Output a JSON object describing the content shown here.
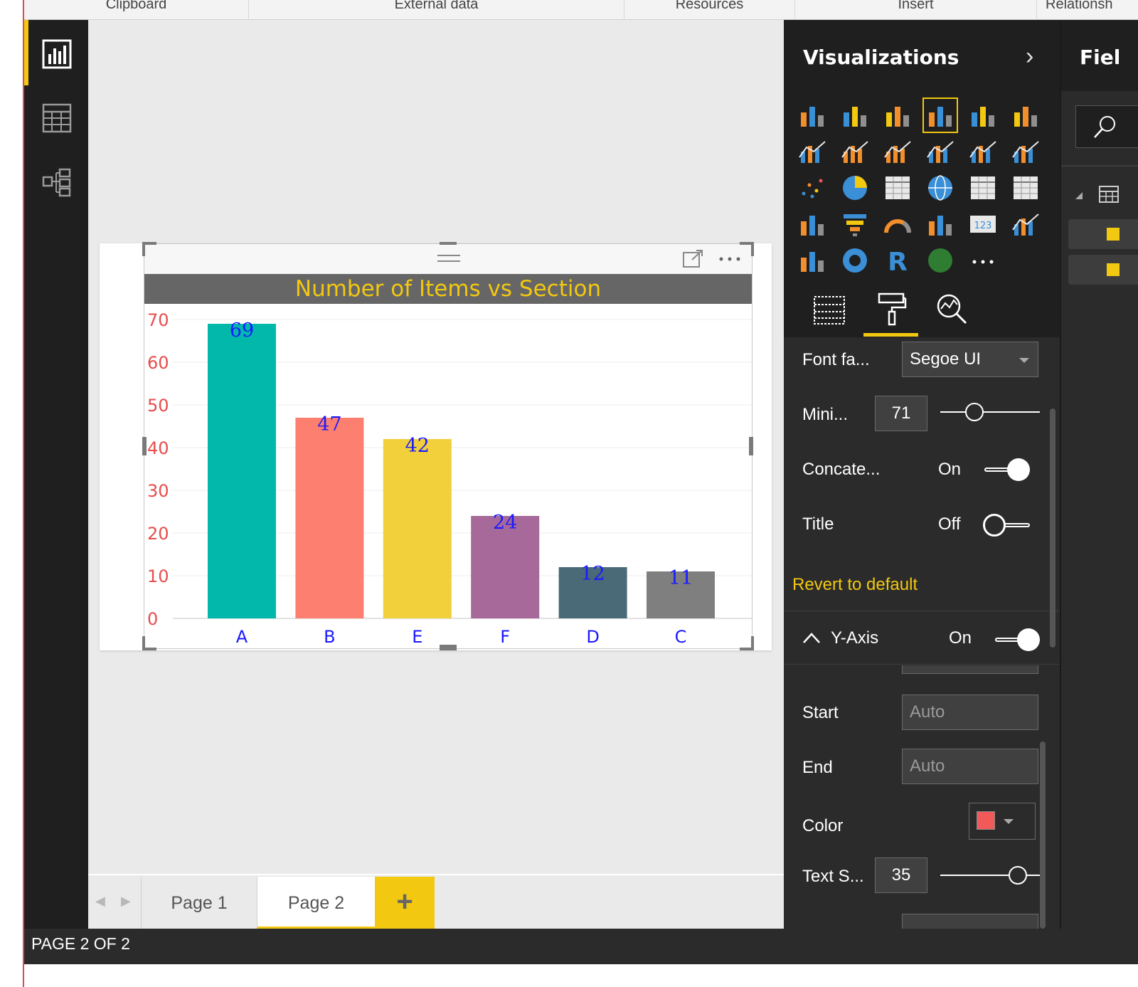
{
  "ribbon": {
    "groups": [
      {
        "label": "Clipboard"
      },
      {
        "label": "External data"
      },
      {
        "label": "Resources"
      },
      {
        "label": "Insert"
      },
      {
        "label": "Relationsh"
      }
    ]
  },
  "leftnav": {
    "items": [
      {
        "name": "report-view-icon",
        "active": true
      },
      {
        "name": "data-view-icon",
        "active": false
      },
      {
        "name": "relationships-view-icon",
        "active": false
      }
    ]
  },
  "visual": {
    "title": "Number of Items vs Section",
    "title_color": "#f2c811",
    "title_bg": "#666666"
  },
  "chart_data": {
    "type": "bar",
    "title": "Number of Items vs Section",
    "categories": [
      "A",
      "B",
      "E",
      "F",
      "D",
      "C"
    ],
    "values": [
      69,
      47,
      42,
      24,
      12,
      11
    ],
    "colors": [
      "#01b8aa",
      "#fd7f6f",
      "#f2d03b",
      "#a66999",
      "#4a6a78",
      "#7f7f7f"
    ],
    "ylim": [
      0,
      70
    ],
    "yticks": [
      0,
      10,
      20,
      30,
      40,
      50,
      60,
      70
    ],
    "ytick_color": "#e84c4c",
    "xtick_color": "#1a1aff",
    "data_label_color": "#1a1aff",
    "grid": true,
    "xlabel": "",
    "ylabel": ""
  },
  "tabs": {
    "items": [
      {
        "label": "Page 1",
        "active": false
      },
      {
        "label": "Page 2",
        "active": true
      }
    ],
    "add_label": "+"
  },
  "status": {
    "text": "PAGE 2 OF 2"
  },
  "viz_pane": {
    "title": "Visualizations",
    "chevron": "›",
    "more_label": "···",
    "format": {
      "font_family_label": "Font fa...",
      "font_family_value": "Segoe UI",
      "minimum_label": "Mini...",
      "minimum_value": "71",
      "concatenate_label": "Concate...",
      "concatenate_state": "On",
      "title_label": "Title",
      "title_state": "Off",
      "revert_label": "Revert to default",
      "yaxis_label": "Y-Axis",
      "yaxis_state": "On",
      "start_label": "Start",
      "start_placeholder": "Auto",
      "end_label": "End",
      "end_placeholder": "Auto",
      "color_label": "Color",
      "color_value": "#f25a5a",
      "text_size_label": "Text S...",
      "text_size_value": "35"
    }
  },
  "fields_pane": {
    "title": "Fiel"
  }
}
